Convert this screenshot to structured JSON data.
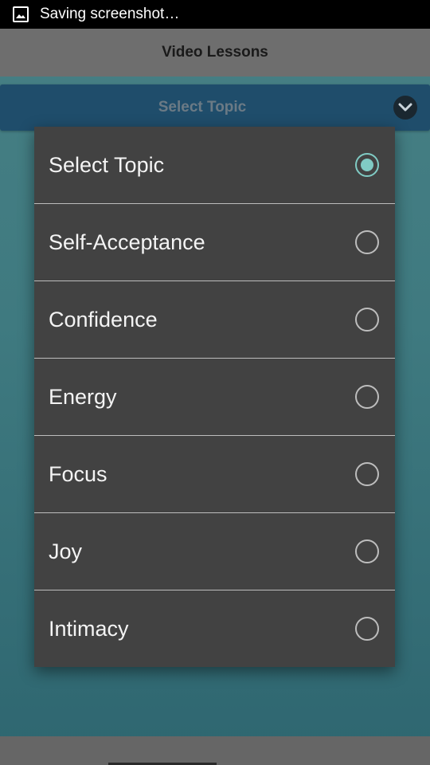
{
  "status_bar": {
    "icon": "image-icon",
    "text": "Saving screenshot…"
  },
  "header": {
    "title": "Video Lessons"
  },
  "topic_selector": {
    "label": "Select Topic",
    "icon": "chevron-down-icon"
  },
  "dialog": {
    "selected_index": 0,
    "accent_color": "#80cbc4",
    "options": [
      {
        "label": "Select Topic",
        "checked": true
      },
      {
        "label": "Self-Acceptance",
        "checked": false
      },
      {
        "label": "Confidence",
        "checked": false
      },
      {
        "label": "Energy",
        "checked": false
      },
      {
        "label": "Focus",
        "checked": false
      },
      {
        "label": "Joy",
        "checked": false
      },
      {
        "label": "Intimacy",
        "checked": false
      }
    ]
  }
}
